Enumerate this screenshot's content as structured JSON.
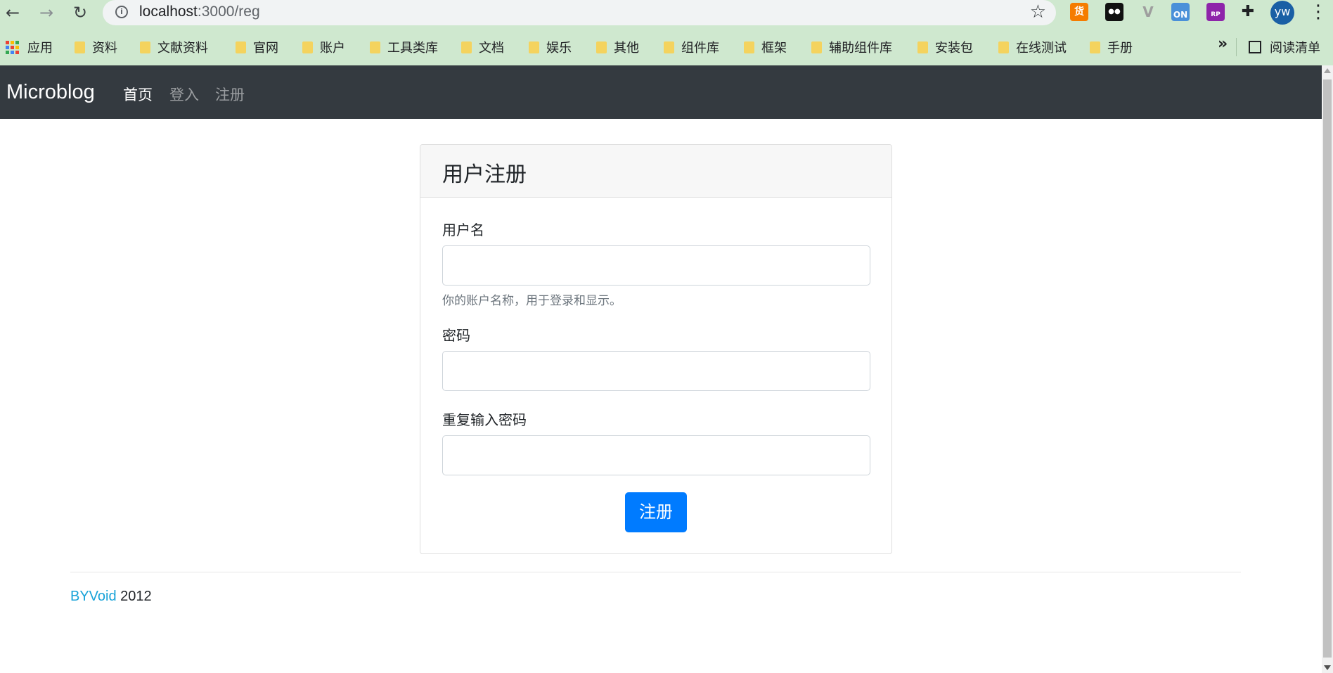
{
  "browser": {
    "url_host": "localhost",
    "url_path": ":3000/reg",
    "profile_initials": "yw",
    "extensions": [
      {
        "name": "huo-extension-icon",
        "label": "货",
        "color": "#f57c00"
      },
      {
        "name": "tampermonkey-icon",
        "label": "●●",
        "color": "#111111"
      },
      {
        "name": "vue-devtools-icon",
        "label": "V",
        "color": "#9e9e9e"
      },
      {
        "name": "on-extension-icon",
        "label": "ON",
        "color": "#2e7d32"
      },
      {
        "name": "rp-extension-icon",
        "label": "RP",
        "color": "#8e24aa"
      }
    ],
    "bookmarks": [
      "应用",
      "资料",
      "文献资料",
      "官网",
      "账户",
      "工具类库",
      "文档",
      "娱乐",
      "其他",
      "组件库",
      "框架",
      "辅助组件库",
      "安装包",
      "在线测试",
      "手册"
    ],
    "more_bookmarks": "»",
    "reading_list": "阅读清单"
  },
  "navbar": {
    "brand": "Microblog",
    "links": [
      "首页",
      "登入",
      "注册"
    ]
  },
  "form": {
    "title": "用户注册",
    "username_label": "用户名",
    "username_help": "你的账户名称，用于登录和显示。",
    "password_label": "密码",
    "repeat_password_label": "重复输入密码",
    "submit_label": "注册"
  },
  "footer": {
    "author": "BYVoid",
    "year": "2012"
  }
}
